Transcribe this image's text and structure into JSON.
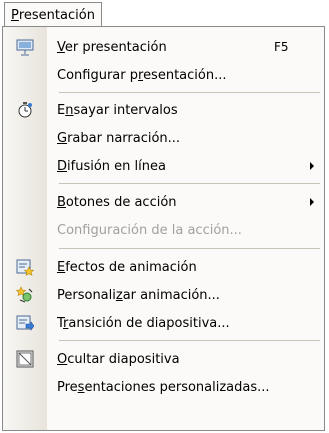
{
  "menu_title": {
    "accel": "P",
    "rest": "resentación"
  },
  "items": [
    {
      "pre": "",
      "accel": "V",
      "post": "er presentación",
      "shortcut": "F5",
      "icon": "slideshow-icon"
    },
    {
      "pre": "Configurar p",
      "accel": "r",
      "post": "esentación...",
      "shortcut": ""
    },
    {
      "pre": "E",
      "accel": "n",
      "post": "sayar intervalos",
      "icon": "stopwatch-icon"
    },
    {
      "pre": "",
      "accel": "G",
      "post": "rabar narración..."
    },
    {
      "pre": "",
      "accel": "D",
      "post": "ifusión en línea",
      "submenu": true
    },
    {
      "pre": "",
      "accel": "B",
      "post": "otones de acción",
      "submenu": true
    },
    {
      "pre": "Confi",
      "accel": "g",
      "post": "uración de la acción...",
      "disabled": true
    },
    {
      "pre": "",
      "accel": "E",
      "post": "fectos de animación",
      "icon": "animation-effects-icon"
    },
    {
      "pre": "Personali",
      "accel": "z",
      "post": "ar animación...",
      "icon": "custom-animation-icon"
    },
    {
      "pre": "T",
      "accel": "r",
      "post": "ansición de diapositiva...",
      "icon": "slide-transition-icon"
    },
    {
      "pre": "",
      "accel": "O",
      "post": "cultar diapositiva",
      "icon": "hide-slide-icon"
    },
    {
      "pre": "Pre",
      "accel": "s",
      "post": "entaciones personalizadas..."
    }
  ],
  "colors": {
    "gutter": "#e8e4dc",
    "disabled": "#a0a0a0",
    "border": "#8a8a8a"
  }
}
